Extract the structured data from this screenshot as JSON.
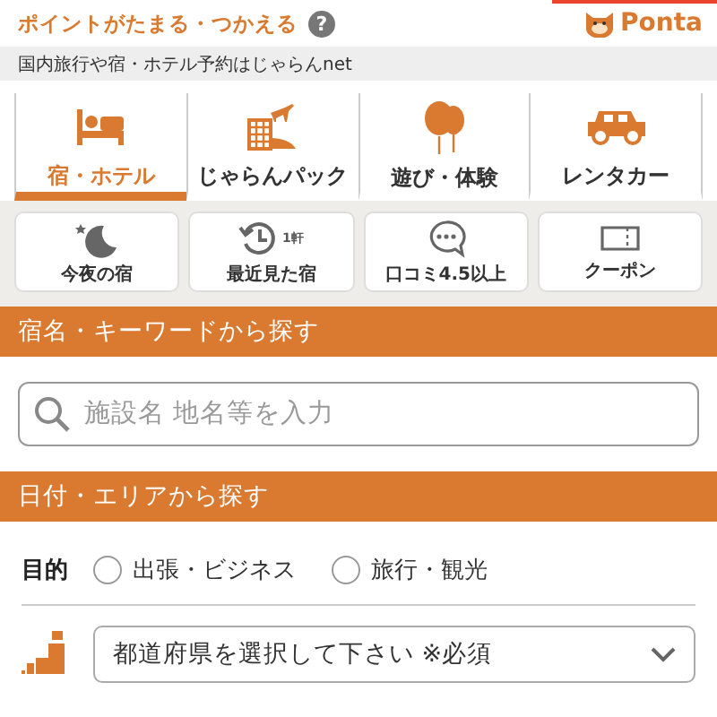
{
  "top_bar": {
    "points_text": "ポイントがたまる・つかえる",
    "help": "?",
    "brand": "Ponta"
  },
  "tagline": "国内旅行や宿・ホテル予約はじゃらんnet",
  "tabs": [
    {
      "label": "宿・ホテル",
      "kind": "bed",
      "selected": true
    },
    {
      "label": "じゃらんパック",
      "kind": "pack",
      "selected": false
    },
    {
      "label": "遊び・体験",
      "kind": "balloon",
      "selected": false
    },
    {
      "label": "レンタカー",
      "kind": "car",
      "selected": false
    }
  ],
  "shortcuts": [
    {
      "label": "今夜の宿",
      "kind": "moon"
    },
    {
      "label": "最近見た宿",
      "kind": "history",
      "badge": "1軒"
    },
    {
      "label": "口コミ4.5以上",
      "kind": "chat"
    },
    {
      "label": "クーポン",
      "kind": "coupon"
    }
  ],
  "keyword_section": {
    "title": "宿名・キーワードから探す",
    "placeholder": "施設名 地名等を入力"
  },
  "area_section": {
    "title": "日付・エリアから探す",
    "purpose_label": "目的",
    "purposes": [
      {
        "label": "出張・ビジネス",
        "selected": false
      },
      {
        "label": "旅行・観光",
        "selected": false
      }
    ],
    "prefecture": "都道府県を選択して下さい ※必須"
  }
}
